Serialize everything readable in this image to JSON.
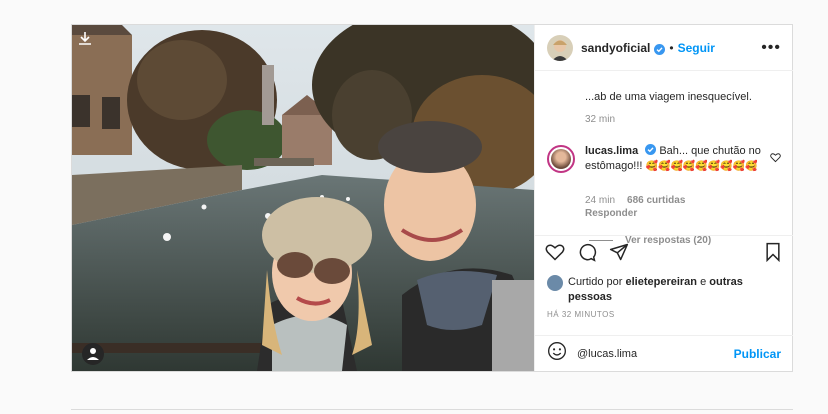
{
  "post": {
    "username": "sandyoficial",
    "follow_label": "Seguir",
    "dot": "•",
    "more_label": "•••"
  },
  "comments": {
    "cut_caption": "...ab de uma viagem inesquecível.",
    "caption_time": "32 min",
    "comment": {
      "username": "lucas.lima",
      "text": "Bah... que chutão no estômago!!!",
      "emojis": "🥰🥰🥰🥰🥰🥰🥰🥰🥰",
      "time": "24 min",
      "likes": "686 curtidas",
      "reply": "Responder"
    },
    "view_replies": "Ver respostas (20)"
  },
  "likes_line": {
    "prefix": "Curtido por",
    "user": "elietepereiran",
    "and": "e",
    "others": "outras pessoas"
  },
  "timestamp": "HÁ 32 MINUTOS",
  "add_comment": {
    "value": "@lucas.lima",
    "publish_label": "Publicar"
  },
  "colors": {
    "accent": "#0095f6",
    "muted": "#8e8e8e",
    "border": "#dbdbdb"
  },
  "icons": [
    "download-icon",
    "user-tag-icon",
    "verified-icon",
    "more-icon",
    "heart-icon",
    "comment-icon",
    "share-icon",
    "bookmark-icon",
    "emoji-icon"
  ]
}
